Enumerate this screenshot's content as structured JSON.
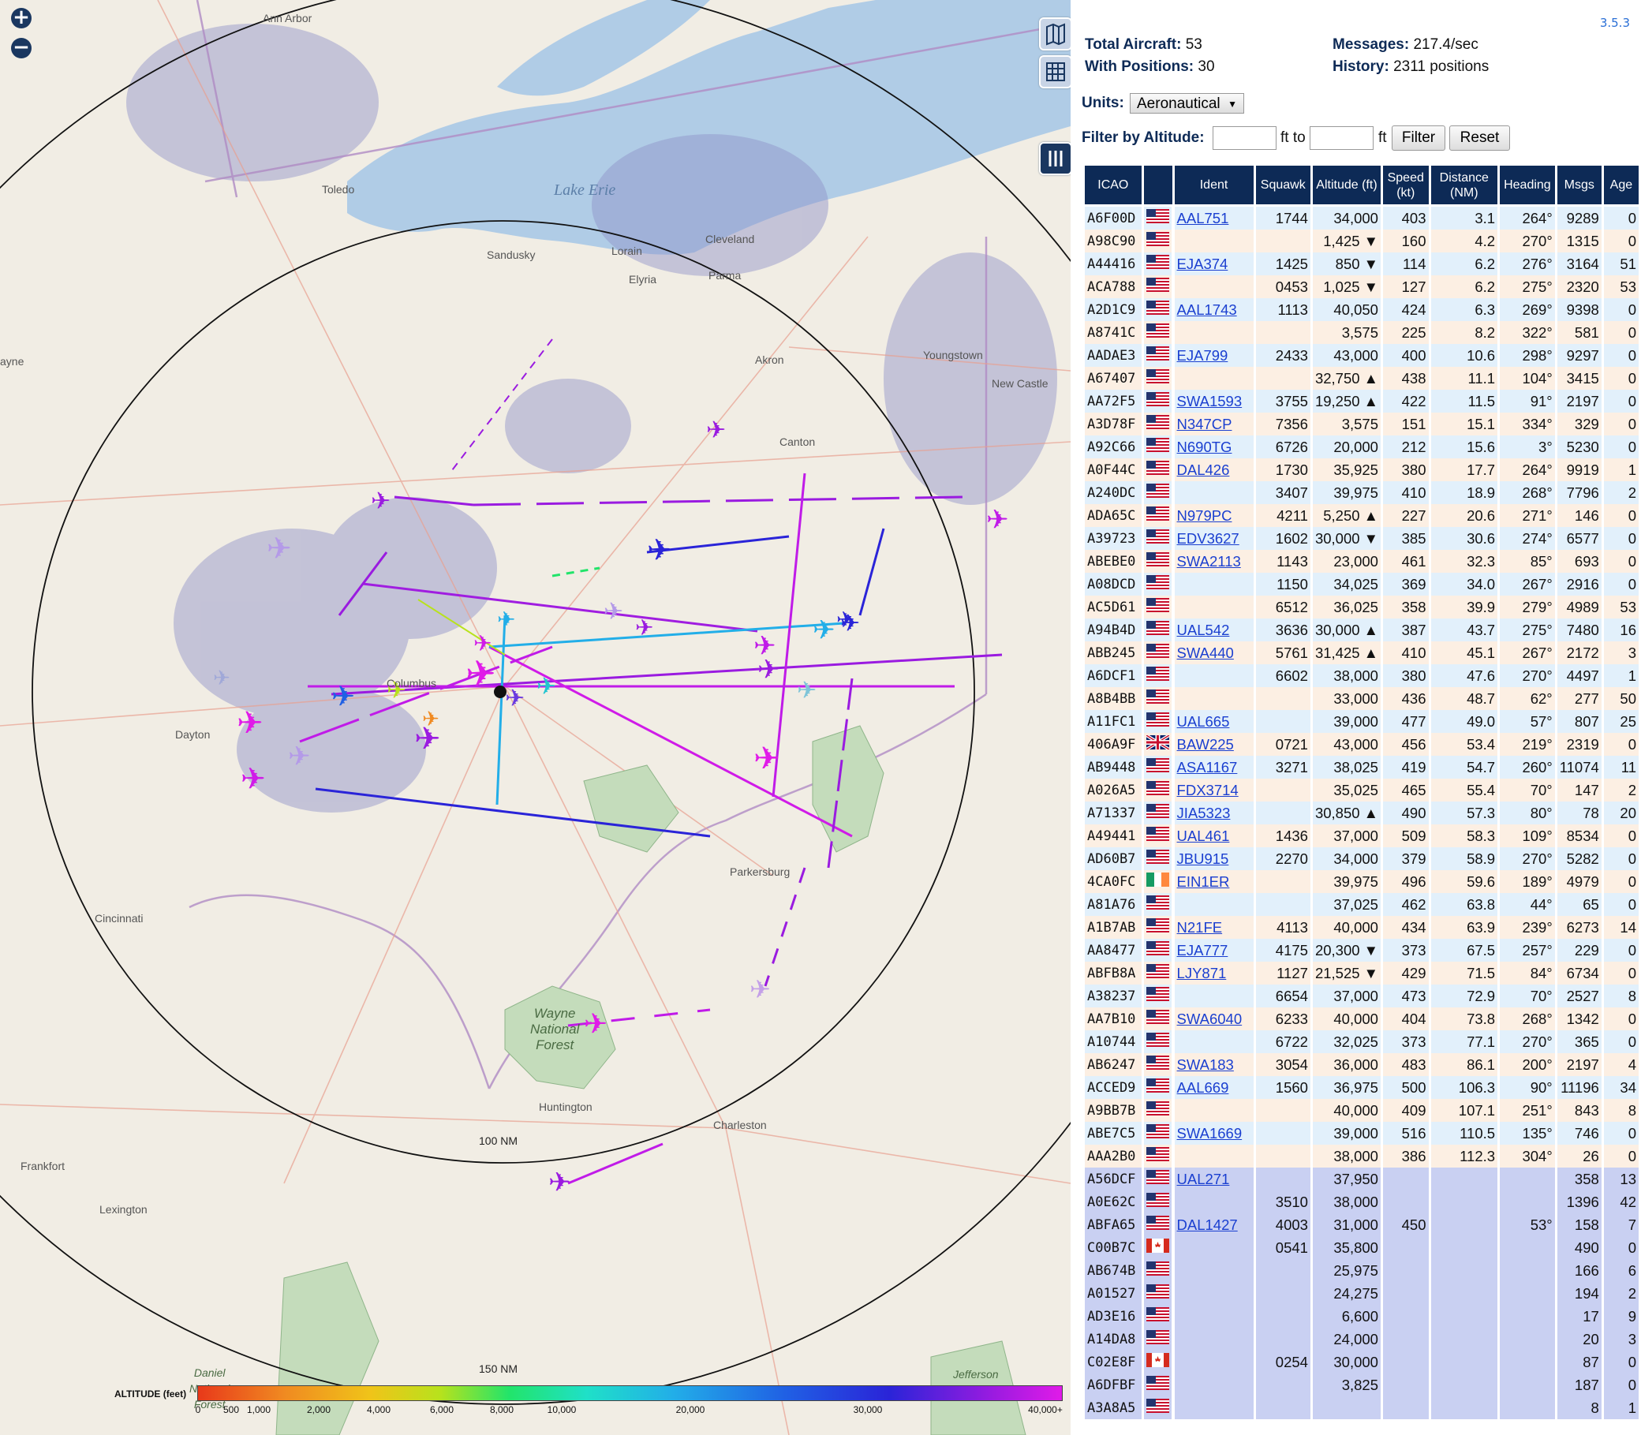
{
  "version": "3.5.3",
  "stats": {
    "total_aircraft_label": "Total Aircraft:",
    "total_aircraft": "53",
    "with_positions_label": "With Positions:",
    "with_positions": "30",
    "messages_label": "Messages:",
    "messages": "217.4/sec",
    "history_label": "History:",
    "history": "2311 positions"
  },
  "controls": {
    "units_label": "Units:",
    "units_value": "Aeronautical",
    "filter_label": "Filter by Altitude:",
    "ft_to": "ft to",
    "ft": "ft",
    "filter_button": "Filter",
    "reset_button": "Reset"
  },
  "map": {
    "zoom_in": "+",
    "zoom_out": "−",
    "range_100": "100 NM",
    "range_150": "150 NM",
    "lake_label": "Lake Erie",
    "forest_label": "Wayne\nNational\nForest",
    "forest_label_2": "Jefferson\nForest",
    "forest_label_3": "Daniel\nNational\nForest",
    "cities": [
      {
        "name": "Ann Arbor"
      },
      {
        "name": "Toledo"
      },
      {
        "name": "Sandusky"
      },
      {
        "name": "Lorain"
      },
      {
        "name": "Cleveland"
      },
      {
        "name": "Elyria"
      },
      {
        "name": "Parma"
      },
      {
        "name": "Akron"
      },
      {
        "name": "Youngstown"
      },
      {
        "name": "New Castle"
      },
      {
        "name": "Canton"
      },
      {
        "name": "Dayton"
      },
      {
        "name": "Cincinnati"
      },
      {
        "name": "Parkersburg"
      },
      {
        "name": "Huntington"
      },
      {
        "name": "Charleston"
      },
      {
        "name": "Frankfort"
      },
      {
        "name": "Lexington"
      },
      {
        "name": "Columbus"
      },
      {
        "name": "ayne"
      }
    ],
    "legend": {
      "title": "ALTITUDE (feet)",
      "ticks": [
        "0",
        "500",
        "1,000",
        "2,000",
        "4,000",
        "6,000",
        "8,000",
        "10,000",
        "20,000",
        "30,000",
        "40,000+"
      ]
    }
  },
  "table": {
    "headers": [
      "ICAO",
      "",
      "Ident",
      "Squawk",
      "Altitude (ft)",
      "Speed (kt)",
      "Distance (NM)",
      "Heading",
      "Msgs",
      "Age"
    ],
    "rows": [
      {
        "icao": "A6F00D",
        "flag": "us",
        "ident": "AAL751",
        "squawk": "1744",
        "alt": "34,000",
        "spd": "403",
        "dist": "3.1",
        "hdg": "264°",
        "msgs": "9289",
        "age": "0"
      },
      {
        "icao": "A98C90",
        "flag": "us",
        "ident": "",
        "squawk": "",
        "alt": "1,425 ▼",
        "spd": "160",
        "dist": "4.2",
        "hdg": "270°",
        "msgs": "1315",
        "age": "0"
      },
      {
        "icao": "A44416",
        "flag": "us",
        "ident": "EJA374",
        "squawk": "1425",
        "alt": "850 ▼",
        "spd": "114",
        "dist": "6.2",
        "hdg": "276°",
        "msgs": "3164",
        "age": "51"
      },
      {
        "icao": "ACA788",
        "flag": "us",
        "ident": "",
        "squawk": "0453",
        "alt": "1,025 ▼",
        "spd": "127",
        "dist": "6.2",
        "hdg": "275°",
        "msgs": "2320",
        "age": "53"
      },
      {
        "icao": "A2D1C9",
        "flag": "us",
        "ident": "AAL1743",
        "squawk": "1113",
        "alt": "40,050",
        "spd": "424",
        "dist": "6.3",
        "hdg": "269°",
        "msgs": "9398",
        "age": "0"
      },
      {
        "icao": "A8741C",
        "flag": "us",
        "ident": "",
        "squawk": "",
        "alt": "3,575",
        "spd": "225",
        "dist": "8.2",
        "hdg": "322°",
        "msgs": "581",
        "age": "0"
      },
      {
        "icao": "AADAE3",
        "flag": "us",
        "ident": "EJA799",
        "squawk": "2433",
        "alt": "43,000",
        "spd": "400",
        "dist": "10.6",
        "hdg": "298°",
        "msgs": "9297",
        "age": "0"
      },
      {
        "icao": "A67407",
        "flag": "us",
        "ident": "",
        "squawk": "",
        "alt": "32,750 ▲",
        "spd": "438",
        "dist": "11.1",
        "hdg": "104°",
        "msgs": "3415",
        "age": "0"
      },
      {
        "icao": "AA72F5",
        "flag": "us",
        "ident": "SWA1593",
        "squawk": "3755",
        "alt": "19,250 ▲",
        "spd": "422",
        "dist": "11.5",
        "hdg": "91°",
        "msgs": "2197",
        "age": "0"
      },
      {
        "icao": "A3D78F",
        "flag": "us",
        "ident": "N347CP",
        "squawk": "7356",
        "alt": "3,575",
        "spd": "151",
        "dist": "15.1",
        "hdg": "334°",
        "msgs": "329",
        "age": "0"
      },
      {
        "icao": "A92C66",
        "flag": "us",
        "ident": "N690TG",
        "squawk": "6726",
        "alt": "20,000",
        "spd": "212",
        "dist": "15.6",
        "hdg": "3°",
        "msgs": "5230",
        "age": "0"
      },
      {
        "icao": "A0F44C",
        "flag": "us",
        "ident": "DAL426",
        "squawk": "1730",
        "alt": "35,925",
        "spd": "380",
        "dist": "17.7",
        "hdg": "264°",
        "msgs": "9919",
        "age": "1"
      },
      {
        "icao": "A240DC",
        "flag": "us",
        "ident": "",
        "squawk": "3407",
        "alt": "39,975",
        "spd": "410",
        "dist": "18.9",
        "hdg": "268°",
        "msgs": "7796",
        "age": "2"
      },
      {
        "icao": "ADA65C",
        "flag": "us",
        "ident": "N979PC",
        "squawk": "4211",
        "alt": "5,250 ▲",
        "spd": "227",
        "dist": "20.6",
        "hdg": "271°",
        "msgs": "146",
        "age": "0"
      },
      {
        "icao": "A39723",
        "flag": "us",
        "ident": "EDV3627",
        "squawk": "1602",
        "alt": "30,000 ▼",
        "spd": "385",
        "dist": "30.6",
        "hdg": "274°",
        "msgs": "6577",
        "age": "0"
      },
      {
        "icao": "ABEBE0",
        "flag": "us",
        "ident": "SWA2113",
        "squawk": "1143",
        "alt": "23,000",
        "spd": "461",
        "dist": "32.3",
        "hdg": "85°",
        "msgs": "693",
        "age": "0"
      },
      {
        "icao": "A08DCD",
        "flag": "us",
        "ident": "",
        "squawk": "1150",
        "alt": "34,025",
        "spd": "369",
        "dist": "34.0",
        "hdg": "267°",
        "msgs": "2916",
        "age": "0"
      },
      {
        "icao": "AC5D61",
        "flag": "us",
        "ident": "",
        "squawk": "6512",
        "alt": "36,025",
        "spd": "358",
        "dist": "39.9",
        "hdg": "279°",
        "msgs": "4989",
        "age": "53"
      },
      {
        "icao": "A94B4D",
        "flag": "us",
        "ident": "UAL542",
        "squawk": "3636",
        "alt": "30,000 ▲",
        "spd": "387",
        "dist": "43.7",
        "hdg": "275°",
        "msgs": "7480",
        "age": "16"
      },
      {
        "icao": "ABB245",
        "flag": "us",
        "ident": "SWA440",
        "squawk": "5761",
        "alt": "31,425 ▲",
        "spd": "410",
        "dist": "45.1",
        "hdg": "267°",
        "msgs": "2172",
        "age": "3"
      },
      {
        "icao": "A6DCF1",
        "flag": "us",
        "ident": "",
        "squawk": "6602",
        "alt": "38,000",
        "spd": "380",
        "dist": "47.6",
        "hdg": "270°",
        "msgs": "4497",
        "age": "1"
      },
      {
        "icao": "A8B4BB",
        "flag": "us",
        "ident": "",
        "squawk": "",
        "alt": "33,000",
        "spd": "436",
        "dist": "48.7",
        "hdg": "62°",
        "msgs": "277",
        "age": "50"
      },
      {
        "icao": "A11FC1",
        "flag": "us",
        "ident": "UAL665",
        "squawk": "",
        "alt": "39,000",
        "spd": "477",
        "dist": "49.0",
        "hdg": "57°",
        "msgs": "807",
        "age": "25"
      },
      {
        "icao": "406A9F",
        "flag": "gb",
        "ident": "BAW225",
        "squawk": "0721",
        "alt": "43,000",
        "spd": "456",
        "dist": "53.4",
        "hdg": "219°",
        "msgs": "2319",
        "age": "0"
      },
      {
        "icao": "AB9448",
        "flag": "us",
        "ident": "ASA1167",
        "squawk": "3271",
        "alt": "38,025",
        "spd": "419",
        "dist": "54.7",
        "hdg": "260°",
        "msgs": "11074",
        "age": "11"
      },
      {
        "icao": "A026A5",
        "flag": "us",
        "ident": "FDX3714",
        "squawk": "",
        "alt": "35,025",
        "spd": "465",
        "dist": "55.4",
        "hdg": "70°",
        "msgs": "147",
        "age": "2"
      },
      {
        "icao": "A71337",
        "flag": "us",
        "ident": "JIA5323",
        "squawk": "",
        "alt": "30,850 ▲",
        "spd": "490",
        "dist": "57.3",
        "hdg": "80°",
        "msgs": "78",
        "age": "20"
      },
      {
        "icao": "A49441",
        "flag": "us",
        "ident": "UAL461",
        "squawk": "1436",
        "alt": "37,000",
        "spd": "509",
        "dist": "58.3",
        "hdg": "109°",
        "msgs": "8534",
        "age": "0"
      },
      {
        "icao": "AD60B7",
        "flag": "us",
        "ident": "JBU915",
        "squawk": "2270",
        "alt": "34,000",
        "spd": "379",
        "dist": "58.9",
        "hdg": "270°",
        "msgs": "5282",
        "age": "0"
      },
      {
        "icao": "4CA0FC",
        "flag": "ie",
        "ident": "EIN1ER",
        "squawk": "",
        "alt": "39,975",
        "spd": "496",
        "dist": "59.6",
        "hdg": "189°",
        "msgs": "4979",
        "age": "0"
      },
      {
        "icao": "A81A76",
        "flag": "us",
        "ident": "",
        "squawk": "",
        "alt": "37,025",
        "spd": "462",
        "dist": "63.8",
        "hdg": "44°",
        "msgs": "65",
        "age": "0"
      },
      {
        "icao": "A1B7AB",
        "flag": "us",
        "ident": "N21FE",
        "squawk": "4113",
        "alt": "40,000",
        "spd": "434",
        "dist": "63.9",
        "hdg": "239°",
        "msgs": "6273",
        "age": "14"
      },
      {
        "icao": "AA8477",
        "flag": "us",
        "ident": "EJA777",
        "squawk": "4175",
        "alt": "20,300 ▼",
        "spd": "373",
        "dist": "67.5",
        "hdg": "257°",
        "msgs": "229",
        "age": "0"
      },
      {
        "icao": "ABFB8A",
        "flag": "us",
        "ident": "LJY871",
        "squawk": "1127",
        "alt": "21,525 ▼",
        "spd": "429",
        "dist": "71.5",
        "hdg": "84°",
        "msgs": "6734",
        "age": "0"
      },
      {
        "icao": "A38237",
        "flag": "us",
        "ident": "",
        "squawk": "6654",
        "alt": "37,000",
        "spd": "473",
        "dist": "72.9",
        "hdg": "70°",
        "msgs": "2527",
        "age": "8"
      },
      {
        "icao": "AA7B10",
        "flag": "us",
        "ident": "SWA6040",
        "squawk": "6233",
        "alt": "40,000",
        "spd": "404",
        "dist": "73.8",
        "hdg": "268°",
        "msgs": "1342",
        "age": "0"
      },
      {
        "icao": "A10744",
        "flag": "us",
        "ident": "",
        "squawk": "6722",
        "alt": "32,025",
        "spd": "373",
        "dist": "77.1",
        "hdg": "270°",
        "msgs": "365",
        "age": "0"
      },
      {
        "icao": "AB6247",
        "flag": "us",
        "ident": "SWA183",
        "squawk": "3054",
        "alt": "36,000",
        "spd": "483",
        "dist": "86.1",
        "hdg": "200°",
        "msgs": "2197",
        "age": "4"
      },
      {
        "icao": "ACCED9",
        "flag": "us",
        "ident": "AAL669",
        "squawk": "1560",
        "alt": "36,975",
        "spd": "500",
        "dist": "106.3",
        "hdg": "90°",
        "msgs": "11196",
        "age": "34"
      },
      {
        "icao": "A9BB7B",
        "flag": "us",
        "ident": "",
        "squawk": "",
        "alt": "40,000",
        "spd": "409",
        "dist": "107.1",
        "hdg": "251°",
        "msgs": "843",
        "age": "8"
      },
      {
        "icao": "ABE7C5",
        "flag": "us",
        "ident": "SWA1669",
        "squawk": "",
        "alt": "39,000",
        "spd": "516",
        "dist": "110.5",
        "hdg": "135°",
        "msgs": "746",
        "age": "0"
      },
      {
        "icao": "AAA2B0",
        "flag": "us",
        "ident": "",
        "squawk": "",
        "alt": "38,000",
        "spd": "386",
        "dist": "112.3",
        "hdg": "304°",
        "msgs": "26",
        "age": "0"
      },
      {
        "icao": "A56DCF",
        "flag": "us",
        "ident": "UAL271",
        "squawk": "",
        "alt": "37,950",
        "spd": "",
        "dist": "",
        "hdg": "",
        "msgs": "358",
        "age": "13",
        "nopos": true
      },
      {
        "icao": "A0E62C",
        "flag": "us",
        "ident": "",
        "squawk": "3510",
        "alt": "38,000",
        "spd": "",
        "dist": "",
        "hdg": "",
        "msgs": "1396",
        "age": "42",
        "nopos": true
      },
      {
        "icao": "ABFA65",
        "flag": "us",
        "ident": "DAL1427",
        "squawk": "4003",
        "alt": "31,000",
        "spd": "450",
        "dist": "",
        "hdg": "53°",
        "msgs": "158",
        "age": "7",
        "nopos": true
      },
      {
        "icao": "C00B7C",
        "flag": "ca",
        "ident": "",
        "squawk": "0541",
        "alt": "35,800",
        "spd": "",
        "dist": "",
        "hdg": "",
        "msgs": "490",
        "age": "0",
        "nopos": true
      },
      {
        "icao": "AB674B",
        "flag": "us",
        "ident": "",
        "squawk": "",
        "alt": "25,975",
        "spd": "",
        "dist": "",
        "hdg": "",
        "msgs": "166",
        "age": "6",
        "nopos": true
      },
      {
        "icao": "A01527",
        "flag": "us",
        "ident": "",
        "squawk": "",
        "alt": "24,275",
        "spd": "",
        "dist": "",
        "hdg": "",
        "msgs": "194",
        "age": "2",
        "nopos": true
      },
      {
        "icao": "AD3E16",
        "flag": "us",
        "ident": "",
        "squawk": "",
        "alt": "6,600",
        "spd": "",
        "dist": "",
        "hdg": "",
        "msgs": "17",
        "age": "9",
        "nopos": true
      },
      {
        "icao": "A14DA8",
        "flag": "us",
        "ident": "",
        "squawk": "",
        "alt": "24,000",
        "spd": "",
        "dist": "",
        "hdg": "",
        "msgs": "20",
        "age": "3",
        "nopos": true
      },
      {
        "icao": "C02E8F",
        "flag": "ca",
        "ident": "",
        "squawk": "0254",
        "alt": "30,000",
        "spd": "",
        "dist": "",
        "hdg": "",
        "msgs": "87",
        "age": "0",
        "nopos": true
      },
      {
        "icao": "A6DFBF",
        "flag": "us",
        "ident": "",
        "squawk": "",
        "alt": "3,825",
        "spd": "",
        "dist": "",
        "hdg": "",
        "msgs": "187",
        "age": "0",
        "nopos": true
      },
      {
        "icao": "A3A8A5",
        "flag": "us",
        "ident": "",
        "squawk": "",
        "alt": "",
        "spd": "",
        "dist": "",
        "hdg": "",
        "msgs": "8",
        "age": "1",
        "nopos": true
      }
    ]
  }
}
